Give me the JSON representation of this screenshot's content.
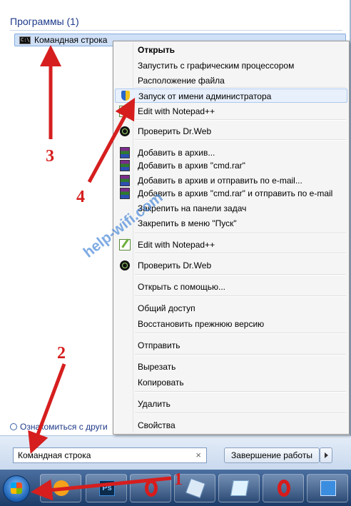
{
  "start_menu": {
    "section_title": "Программы (1)",
    "program": {
      "label": "Командная строка",
      "icon": "cmd-icon"
    },
    "see_more_label": "Ознакомиться с други",
    "search": {
      "value": "Командная строка",
      "clear_glyph": "×"
    },
    "shutdown_label": "Завершение работы"
  },
  "context_menu": {
    "items": [
      {
        "label": "Открыть",
        "bold": true
      },
      {
        "label": "Запустить с графическим процессором"
      },
      {
        "label": "Расположение файла"
      },
      {
        "label": "Запуск от имени администратора",
        "icon": "uac-shield-icon",
        "highlighted": true
      },
      {
        "label": "Edit with Notepad++",
        "icon": "notepad-plus-icon"
      },
      {
        "label": "Проверить Dr.Web",
        "icon": "drweb-icon"
      },
      {
        "label": "Добавить в архив...",
        "icon": "winrar-icon"
      },
      {
        "label": "Добавить в архив \"cmd.rar\"",
        "icon": "winrar-icon"
      },
      {
        "label": "Добавить в архив и отправить по e-mail...",
        "icon": "winrar-icon"
      },
      {
        "label": "Добавить в архив \"cmd.rar\" и отправить по e-mail",
        "icon": "winrar-icon"
      },
      {
        "label": "Закрепить на панели задач"
      },
      {
        "label": "Закрепить в меню \"Пуск\""
      },
      {
        "label": "Edit with Notepad++",
        "icon": "notepad-plus-icon"
      },
      {
        "label": "Проверить Dr.Web",
        "icon": "drweb-icon"
      },
      {
        "label": "Открыть с помощью..."
      },
      {
        "label": "Общий доступ"
      },
      {
        "label": "Восстановить прежнюю версию"
      },
      {
        "label": "Отправить"
      },
      {
        "label": "Вырезать"
      },
      {
        "label": "Копировать"
      },
      {
        "label": "Удалить"
      },
      {
        "label": "Свойства"
      }
    ]
  },
  "taskbar": {
    "start_button": "windows-start-orb",
    "buttons": [
      "avast-icon",
      "photoshop-icon",
      "opera-icon",
      "pen-tool-icon",
      "sticky-notes-icon",
      "opera-icon",
      "control-panel-icon"
    ],
    "photoshop_text": "Ps"
  },
  "watermark": "help-wifi.com",
  "annotations": {
    "step1": "1",
    "step2": "2",
    "step3": "3",
    "step4": "4",
    "color": "#d61e1e"
  }
}
